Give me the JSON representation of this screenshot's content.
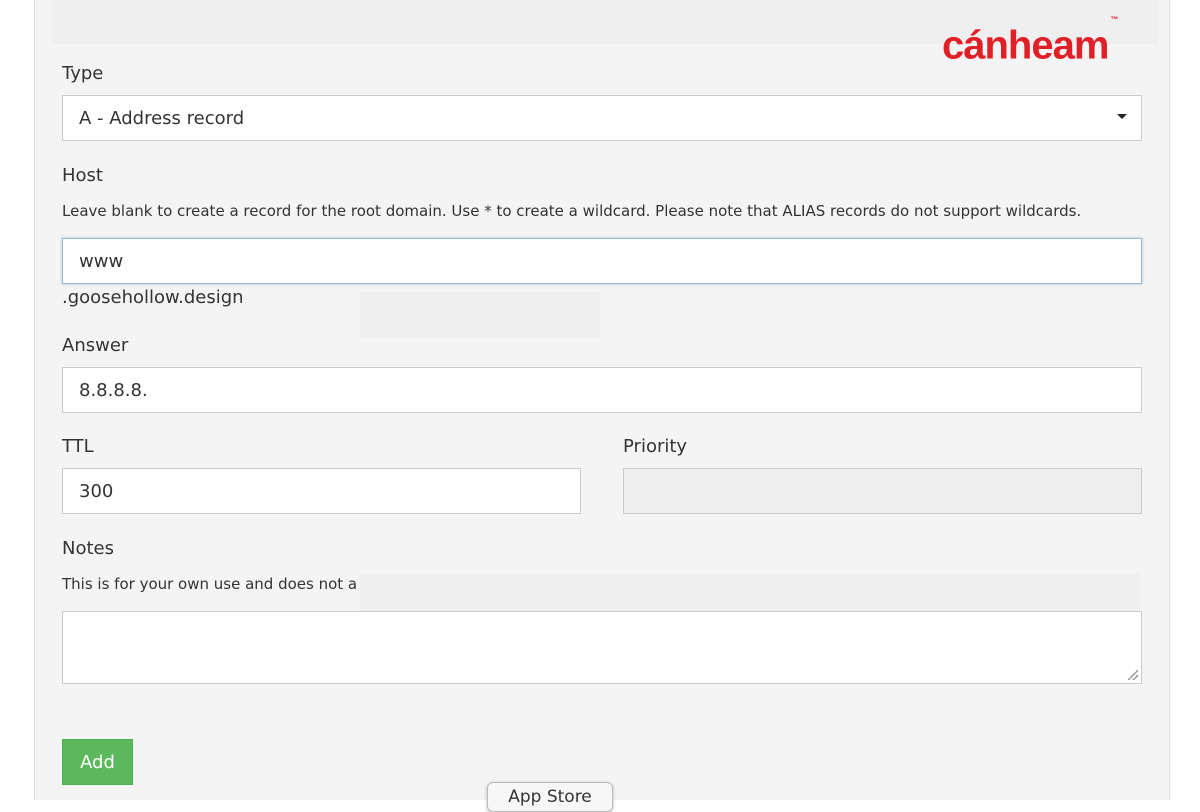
{
  "brand": {
    "logo_text": "cánheam",
    "trademark": "™",
    "color": "#e11f26"
  },
  "form": {
    "type": {
      "label": "Type",
      "value": "A - Address record"
    },
    "host": {
      "label": "Host",
      "help": "Leave blank to create a record for the root domain. Use * to create a wildcard. Please note that ALIAS records do not support wildcards.",
      "value": "www",
      "suffix": ".goosehollow.design"
    },
    "answer": {
      "label": "Answer",
      "value": "8.8.8.8."
    },
    "ttl": {
      "label": "TTL",
      "value": "300"
    },
    "priority": {
      "label": "Priority",
      "value": ""
    },
    "notes": {
      "label": "Notes",
      "help": "This is for your own use and does not a",
      "value": ""
    },
    "add_label": "Add",
    "add_color": "#5cb85c"
  },
  "dock": {
    "app_store_label": "App Store"
  }
}
